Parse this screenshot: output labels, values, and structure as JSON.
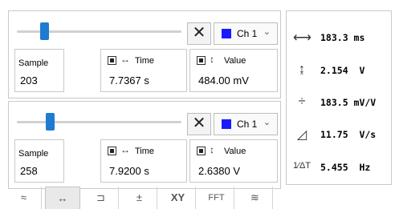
{
  "cursors": [
    {
      "slider": {
        "position": 0.17
      },
      "close_label": "✕",
      "channel": {
        "label": "Ch 1",
        "color": "#1a1aff"
      },
      "sample": {
        "label": "Sample",
        "value": "203"
      },
      "time": {
        "label": "Time",
        "value": "7.7367 s"
      },
      "value": {
        "label": "Value",
        "value": "484.00 mV"
      }
    },
    {
      "slider": {
        "position": 0.2
      },
      "close_label": "✕",
      "channel": {
        "label": "Ch 1",
        "color": "#1a1aff"
      },
      "sample": {
        "label": "Sample",
        "value": "258"
      },
      "time": {
        "label": "Time",
        "value": "7.9200 s"
      },
      "value": {
        "label": "Value",
        "value": "2.6380 V"
      }
    }
  ],
  "measurements": [
    {
      "icon": "delta-time-icon",
      "text": "183.3 ms"
    },
    {
      "icon": "delta-value-icon",
      "text": "2.154  V"
    },
    {
      "icon": "divide-icon",
      "text": "183.5 mV/V"
    },
    {
      "icon": "slope-icon",
      "text": "11.75  V/s"
    },
    {
      "icon": "frequency-icon",
      "text": "5.455  Hz"
    }
  ],
  "tabs": [
    {
      "icon": "waveform-icon",
      "label": "≈"
    },
    {
      "icon": "horizontal-cursor-icon",
      "label": "↔"
    },
    {
      "icon": "trigger-icon",
      "label": "⊐"
    },
    {
      "icon": "math-icon",
      "label": "±"
    },
    {
      "icon": "xy-icon",
      "label": "XY"
    },
    {
      "icon": "fft-icon",
      "label": "FFT"
    },
    {
      "icon": "filter-icon",
      "label": "≋"
    }
  ]
}
